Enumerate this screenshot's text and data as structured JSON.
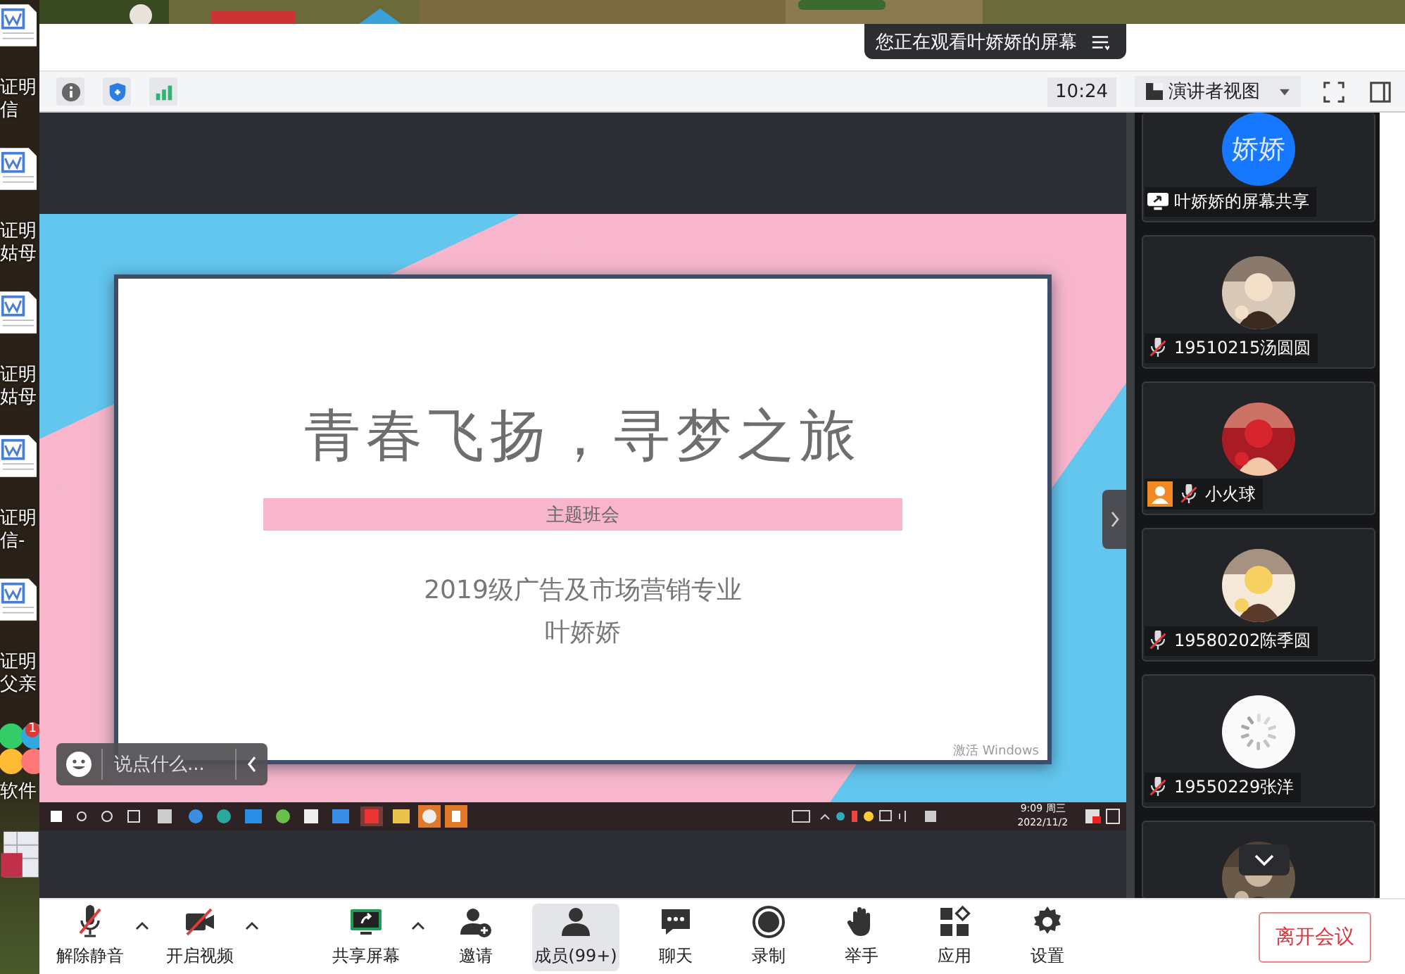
{
  "desktop_icons": [
    {
      "kind": "document",
      "lines": [
        "证明",
        "信"
      ]
    },
    {
      "kind": "document",
      "lines": [
        "证明",
        "姑母"
      ]
    },
    {
      "kind": "document",
      "lines": [
        "证明",
        "姑母"
      ]
    },
    {
      "kind": "document",
      "lines": [
        "证明",
        "信-"
      ]
    },
    {
      "kind": "document",
      "lines": [
        "证明",
        "父亲"
      ]
    },
    {
      "kind": "app_group",
      "lines": [
        "软件"
      ],
      "badge": "1"
    },
    {
      "kind": "database"
    }
  ],
  "banner": {
    "text": "您正在观看叶娇娇的屏幕"
  },
  "toolbar": {
    "time": "10:24",
    "view_button": "演讲者视图"
  },
  "shared_screen": {
    "slide": {
      "title": "青春飞扬，寻梦之旅",
      "subtitle": "主题班会",
      "lines": [
        "2019级广告及市场营销专业",
        "叶娇娇"
      ]
    },
    "watermark": "激活 Windows",
    "taskbar_clock": [
      "9:09 周三",
      "2022/11/2"
    ],
    "chat_box": {
      "placeholder": "说点什么..."
    }
  },
  "participants": [
    {
      "kind": "screen_share",
      "name": "叶娇娇的屏幕共享",
      "avatar": {
        "kind": "text",
        "text": "娇娇"
      }
    },
    {
      "kind": "member",
      "name": "19510215汤圆圆",
      "muted": true,
      "self": false
    },
    {
      "kind": "member",
      "name": "小火球",
      "muted": true,
      "self": true
    },
    {
      "kind": "member",
      "name": "19580202陈季圆",
      "muted": true,
      "self": false
    },
    {
      "kind": "member",
      "name": "19550229张洋",
      "muted": true,
      "self": false,
      "avatar": {
        "kind": "loading"
      }
    },
    {
      "kind": "member"
    }
  ],
  "controls": [
    {
      "kind": "unmute",
      "label": "解除静音",
      "menu": true,
      "selected": false
    },
    {
      "kind": "video",
      "label": "开启视频",
      "menu": true,
      "selected": false
    },
    {
      "kind": "share",
      "label": "共享屏幕",
      "menu": true,
      "selected": false
    },
    {
      "kind": "invite",
      "label": "邀请",
      "menu": false,
      "selected": false
    },
    {
      "kind": "members",
      "label": "成员(99+)",
      "menu": false,
      "selected": true
    },
    {
      "kind": "chat",
      "label": "聊天",
      "menu": false,
      "selected": false
    },
    {
      "kind": "record",
      "label": "录制",
      "menu": false,
      "selected": false
    },
    {
      "kind": "hand",
      "label": "举手",
      "menu": false,
      "selected": false
    },
    {
      "kind": "apps",
      "label": "应用",
      "menu": false,
      "selected": false
    },
    {
      "kind": "settings",
      "label": "设置",
      "menu": false,
      "selected": false
    }
  ],
  "leave_button": "离开会议"
}
